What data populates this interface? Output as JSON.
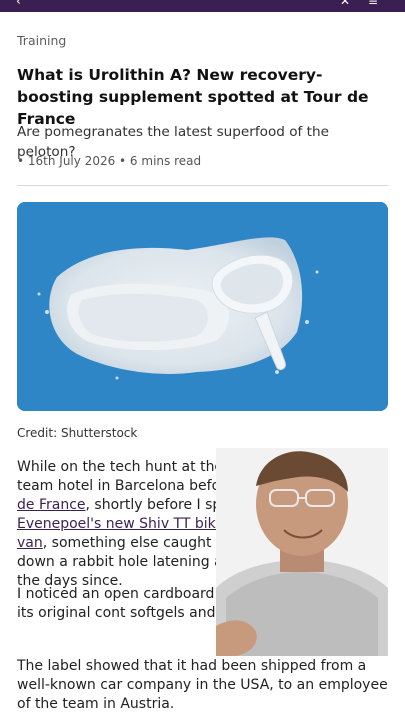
{
  "article": {
    "category": "Training",
    "headline": "What is Urolithin A? New recovery-boosting supplement spotted at Tour de France",
    "standfirst": "Are pomegranates the latest superfood of the peloton?",
    "meta": "• 16th July 2026 • 6 mins read",
    "credit": "Credit: Shutterstock",
    "p1": {
      "t1": "While on the tech hunt at the Red Bull-Bora-h",
      "t2": "he team hotel in Barcelona before the start of ",
      "link1": "the Tour de France",
      "t3": ", shortly before I spotted ",
      "link2": "Remco Evenepoel's new Shiv TT bike in the back of an open van",
      "t4": ", something else caught my eye and sent me down a rabbit hole lat",
      "t5": "ening and over the course of the days since."
    },
    "p2": "I noticed an open cardboard box w the side detailing its original cont softgels and gummies.",
    "p3": "The label showed that it had been shipped from a well-known car company in the USA, to an employee of the team in Austria."
  },
  "icons": {
    "topbar_left": "back-icon",
    "topbar_right": "share-icon"
  },
  "colors": {
    "topbar": "#3b1f52",
    "link": "#3b1f52",
    "hero_bg": "#2f86c7"
  }
}
